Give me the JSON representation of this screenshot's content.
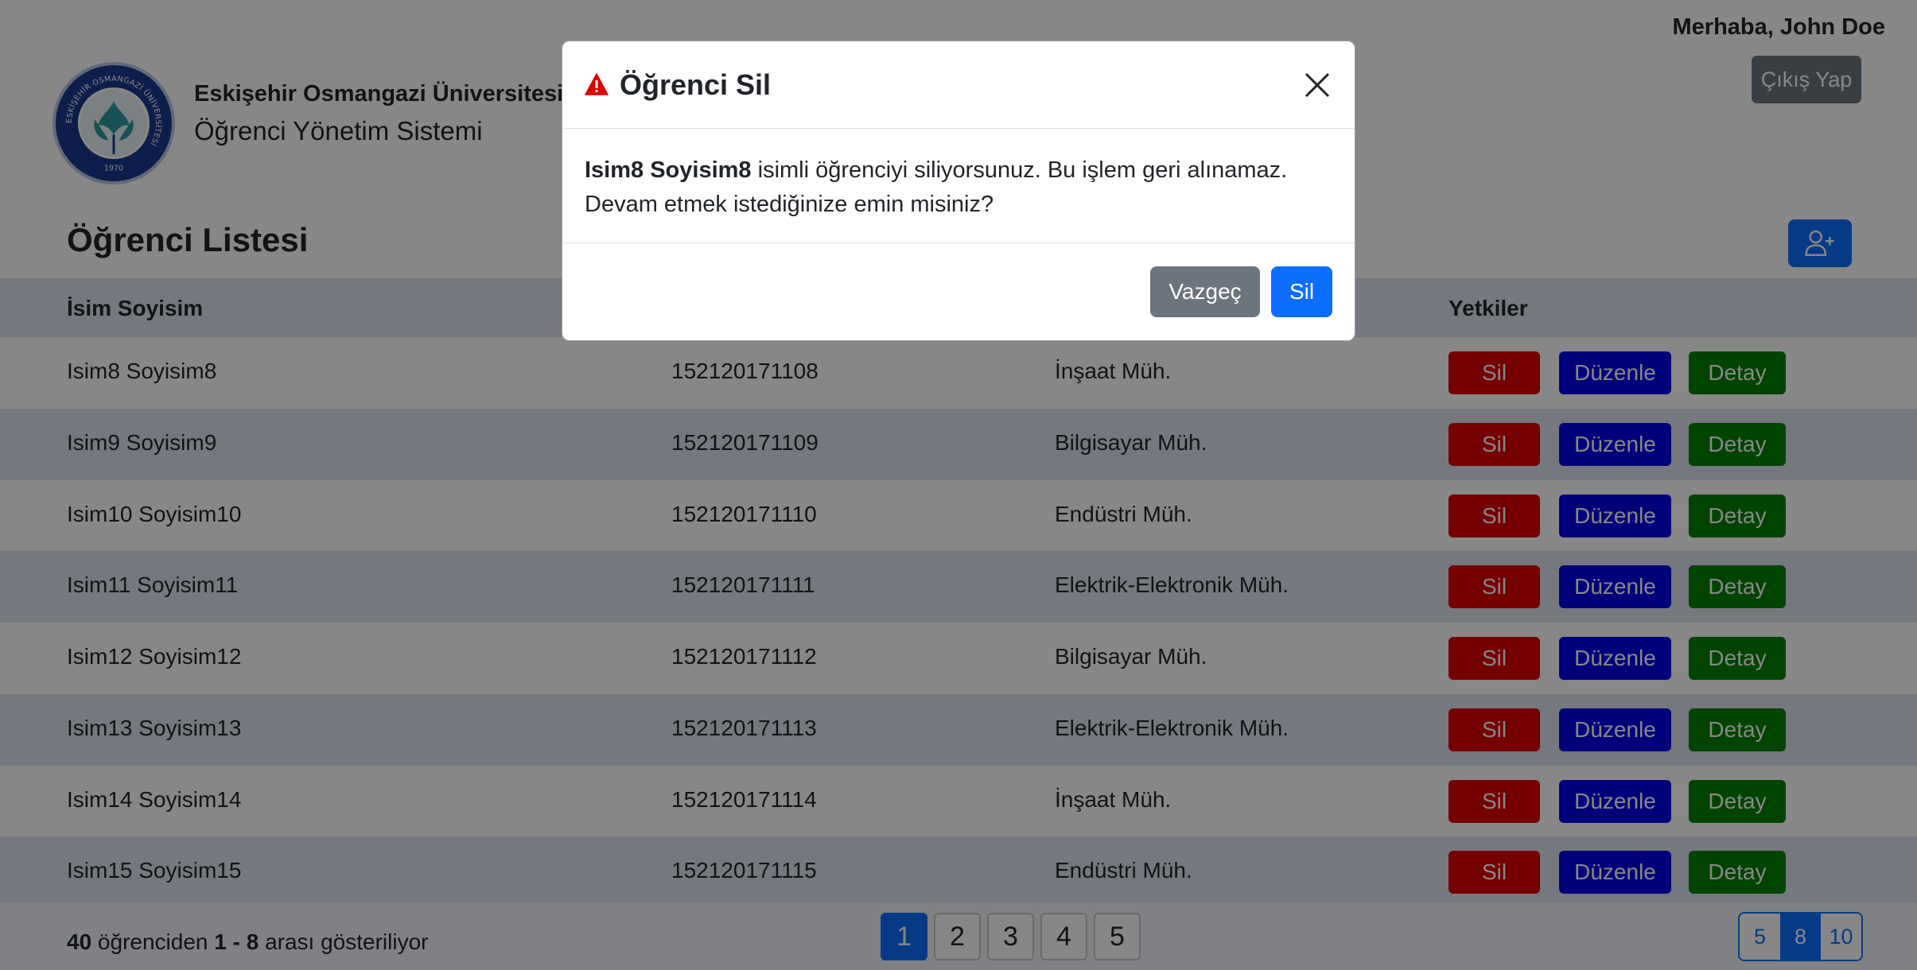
{
  "header": {
    "greeting": "Merhaba, John Doe",
    "logout_label": "Çıkış Yap",
    "university": "Eskişehir Osmangazi Üniversitesi",
    "system": "Öğrenci Yönetim Sistemi",
    "logo_ring_text": "ESKİŞEHİR OSMANGAZİ ÜNİVERSİTESİ",
    "logo_year": "1970"
  },
  "list": {
    "title": "Öğrenci Listesi",
    "add_icon": "add-user-icon",
    "columns": [
      "İsim Soyisim",
      "",
      "",
      "Yetkiler"
    ],
    "actions": {
      "delete": "Sil",
      "edit": "Düzenle",
      "detail": "Detay"
    },
    "rows": [
      {
        "name": "Isim8 Soyisim8",
        "number": "152120171108",
        "department": "İnşaat Müh."
      },
      {
        "name": "Isim9 Soyisim9",
        "number": "152120171109",
        "department": "Bilgisayar Müh."
      },
      {
        "name": "Isim10 Soyisim10",
        "number": "152120171110",
        "department": "Endüstri Müh."
      },
      {
        "name": "Isim11 Soyisim11",
        "number": "152120171111",
        "department": "Elektrik-Elektronik Müh."
      },
      {
        "name": "Isim12 Soyisim12",
        "number": "152120171112",
        "department": "Bilgisayar Müh."
      },
      {
        "name": "Isim13 Soyisim13",
        "number": "152120171113",
        "department": "Elektrik-Elektronik Müh."
      },
      {
        "name": "Isim14 Soyisim14",
        "number": "152120171114",
        "department": "İnşaat Müh."
      },
      {
        "name": "Isim15 Soyisim15",
        "number": "152120171115",
        "department": "Endüstri Müh."
      }
    ]
  },
  "footer": {
    "total": "40",
    "total_suffix": " öğrenciden ",
    "range": "1 - 8",
    "range_suffix": " arası gösteriliyor",
    "pages": [
      "1",
      "2",
      "3",
      "4",
      "5"
    ],
    "active_page": "1",
    "per_page_options": [
      "5",
      "8",
      "10"
    ],
    "active_per_page": "8"
  },
  "modal": {
    "title": "Öğrenci Sil",
    "warning_icon": "warning-triangle-icon",
    "close_icon": "close-icon",
    "student_name": "Isim8 Soyisim8",
    "message_line1": " isimli öğrenciyi siliyorsunuz. Bu işlem geri alınamaz.",
    "message_line2": "Devam etmek istediğinize emin misiniz?",
    "cancel_label": "Vazgeç",
    "confirm_label": "Sil"
  },
  "colors": {
    "primary": "#0d6efd",
    "secondary": "#6c757d",
    "danger": "#dc0000",
    "edit": "#0000e6",
    "success": "#008000",
    "row_alt": "#dde3ef",
    "warning_icon": "#dc0000"
  }
}
